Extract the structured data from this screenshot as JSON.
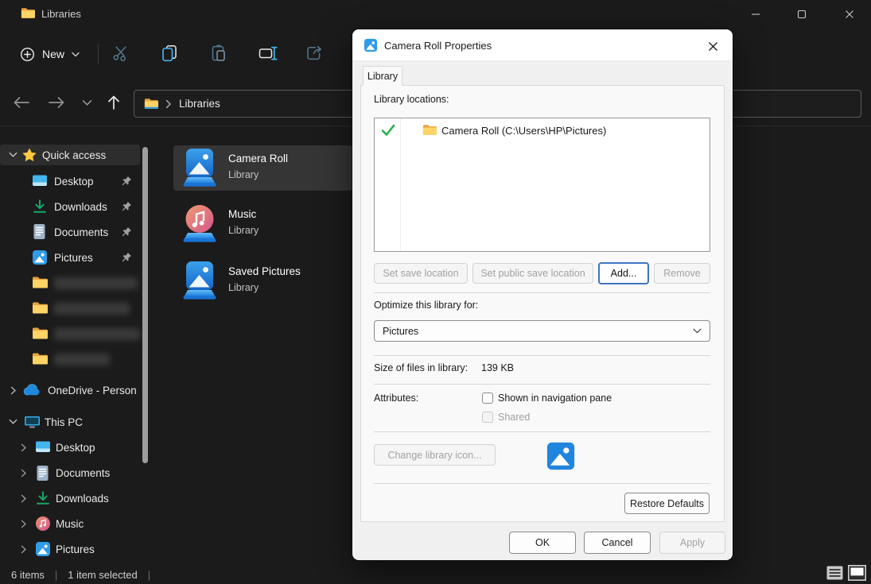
{
  "window": {
    "title": "Libraries"
  },
  "toolbar": {
    "new_label": "New"
  },
  "navbar": {
    "breadcrumb": "Libraries"
  },
  "sidebar": {
    "quick_access_label": "Quick access",
    "pinned": [
      {
        "label": "Desktop"
      },
      {
        "label": "Downloads"
      },
      {
        "label": "Documents"
      },
      {
        "label": "Pictures"
      }
    ],
    "redacted_folder_count": 4,
    "onedrive_label": "OneDrive - Person",
    "this_pc_label": "This PC",
    "this_pc_items": [
      {
        "label": "Desktop"
      },
      {
        "label": "Documents"
      },
      {
        "label": "Downloads"
      },
      {
        "label": "Music"
      },
      {
        "label": "Pictures"
      }
    ]
  },
  "files": [
    {
      "name": "Camera Roll",
      "type": "Library",
      "selected": true
    },
    {
      "name": "Music",
      "type": "Library",
      "selected": false
    },
    {
      "name": "Saved Pictures",
      "type": "Library",
      "selected": false
    }
  ],
  "statusbar": {
    "count": "6 items",
    "selected": "1 item selected",
    "divider": "|"
  },
  "dialog": {
    "title": "Camera Roll Properties",
    "tab_label": "Library",
    "locations_label": "Library locations:",
    "location": "Camera Roll (C:\\Users\\HP\\Pictures)",
    "set_save_label": "Set save location",
    "set_public_label": "Set public save location",
    "add_label": "Add...",
    "remove_label": "Remove",
    "optimize_label": "Optimize this library for:",
    "optimize_value": "Pictures",
    "size_label": "Size of files in library:",
    "size_value": "139 KB",
    "attributes_label": "Attributes:",
    "attr_nav_pane": "Shown in navigation pane",
    "attr_shared": "Shared",
    "change_icon_label": "Change library icon...",
    "restore_label": "Restore Defaults",
    "ok_label": "OK",
    "cancel_label": "Cancel",
    "apply_label": "Apply"
  },
  "icons": {
    "titlebar": [
      "folder-icon",
      "minimize-icon",
      "maximize-icon",
      "close-icon"
    ],
    "toolbar": [
      "plus-circle-icon",
      "chevron-down-icon",
      "cut-icon",
      "copy-icon",
      "paste-icon",
      "rename-icon",
      "share-icon"
    ],
    "navbar": [
      "back-arrow-icon",
      "forward-arrow-icon",
      "recent-chevron-icon",
      "up-arrow-icon",
      "folder-icon",
      "breadcrumb-chevron-icon"
    ],
    "sidebar": [
      "star-icon",
      "desktop-icon",
      "downloads-icon",
      "documents-icon",
      "pictures-icon",
      "pin-icon",
      "folder-icon",
      "onedrive-cloud-icon",
      "this-pc-icon",
      "music-icon"
    ],
    "files": [
      "pictures-library-icon",
      "music-library-icon"
    ],
    "dialog": [
      "pictures-glyph-icon",
      "check-icon",
      "folder-icon",
      "dropdown-chevron-icon"
    ],
    "statusbar": [
      "details-view-icon",
      "large-icons-view-icon"
    ]
  },
  "colors": {
    "window_bg": "#1b1b1b",
    "selection_bg": "#353535",
    "accent_blue": "#3d74c4",
    "library_blue": "#2285dd",
    "check_green": "#25b14d",
    "folder_yellow": "#ffd466",
    "dialog_bg": "#f0f0f0"
  }
}
